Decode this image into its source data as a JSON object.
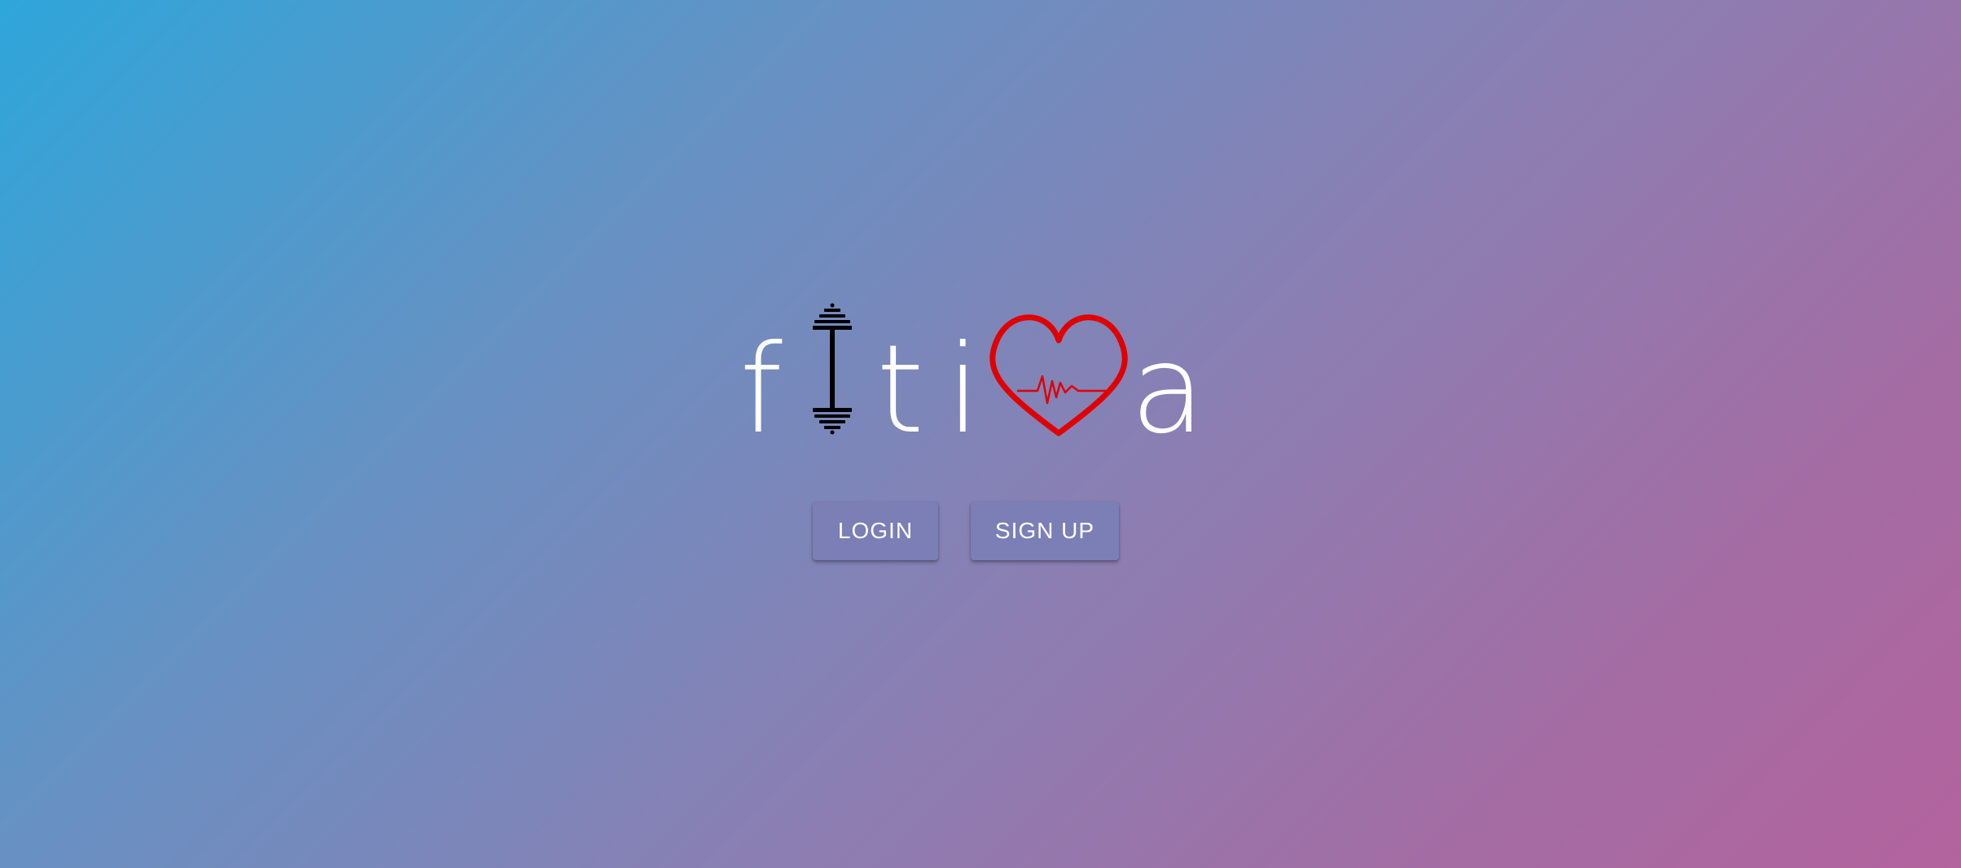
{
  "logo": {
    "text": "fitiva",
    "letters": [
      "f",
      "t",
      "i",
      "a"
    ],
    "icons": [
      "dumbbell-icon",
      "heartbeat-icon"
    ],
    "icon_colors": {
      "dumbbell": "#000000",
      "heart": "#e00000"
    }
  },
  "actions": {
    "login_label": "LOGIN",
    "signup_label": "SIGN UP"
  },
  "colors": {
    "gradient_start": "#2ea6da",
    "gradient_end": "#b3639e",
    "button_bg": "#7b7fb6",
    "button_text": "#ffffff"
  }
}
